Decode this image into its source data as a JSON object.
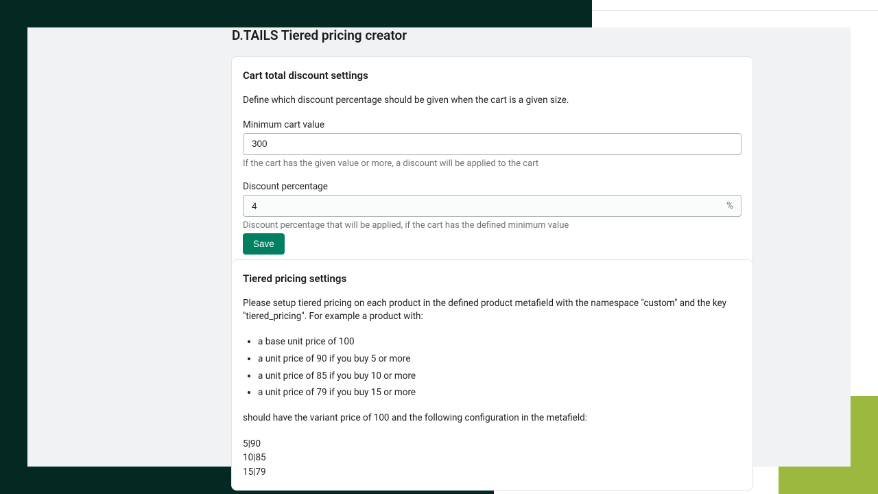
{
  "page_title": "D.TAILS Tiered pricing creator",
  "card1": {
    "title": "Cart total discount settings",
    "desc": "Define which discount percentage should be given when the cart is a given size.",
    "min_label": "Minimum cart value",
    "min_value": "300",
    "min_help": "If the cart has the given value or more, a discount will be applied to the cart",
    "pct_label": "Discount percentage",
    "pct_value": "4",
    "pct_suffix": "%",
    "pct_help": "Discount percentage that will be applied, if the cart has the defined minimum value",
    "save_label": "Save"
  },
  "card2": {
    "title": "Tiered pricing settings",
    "desc": "Please setup tiered pricing on each product in the defined product metafield with the namespace \"custom\" and the key \"tiered_pricing\". For example a product with:",
    "bullets": [
      "a base unit price of 100",
      "a unit price of 90 if you buy 5 or more",
      "a unit price of 85 if you buy 10 or more",
      "a unit price of 79 if you buy 15 or more"
    ],
    "after": "should have the variant price of 100 and the following configuration in the metafield:",
    "codes": [
      "5|90",
      "10|85",
      "15|79"
    ]
  }
}
